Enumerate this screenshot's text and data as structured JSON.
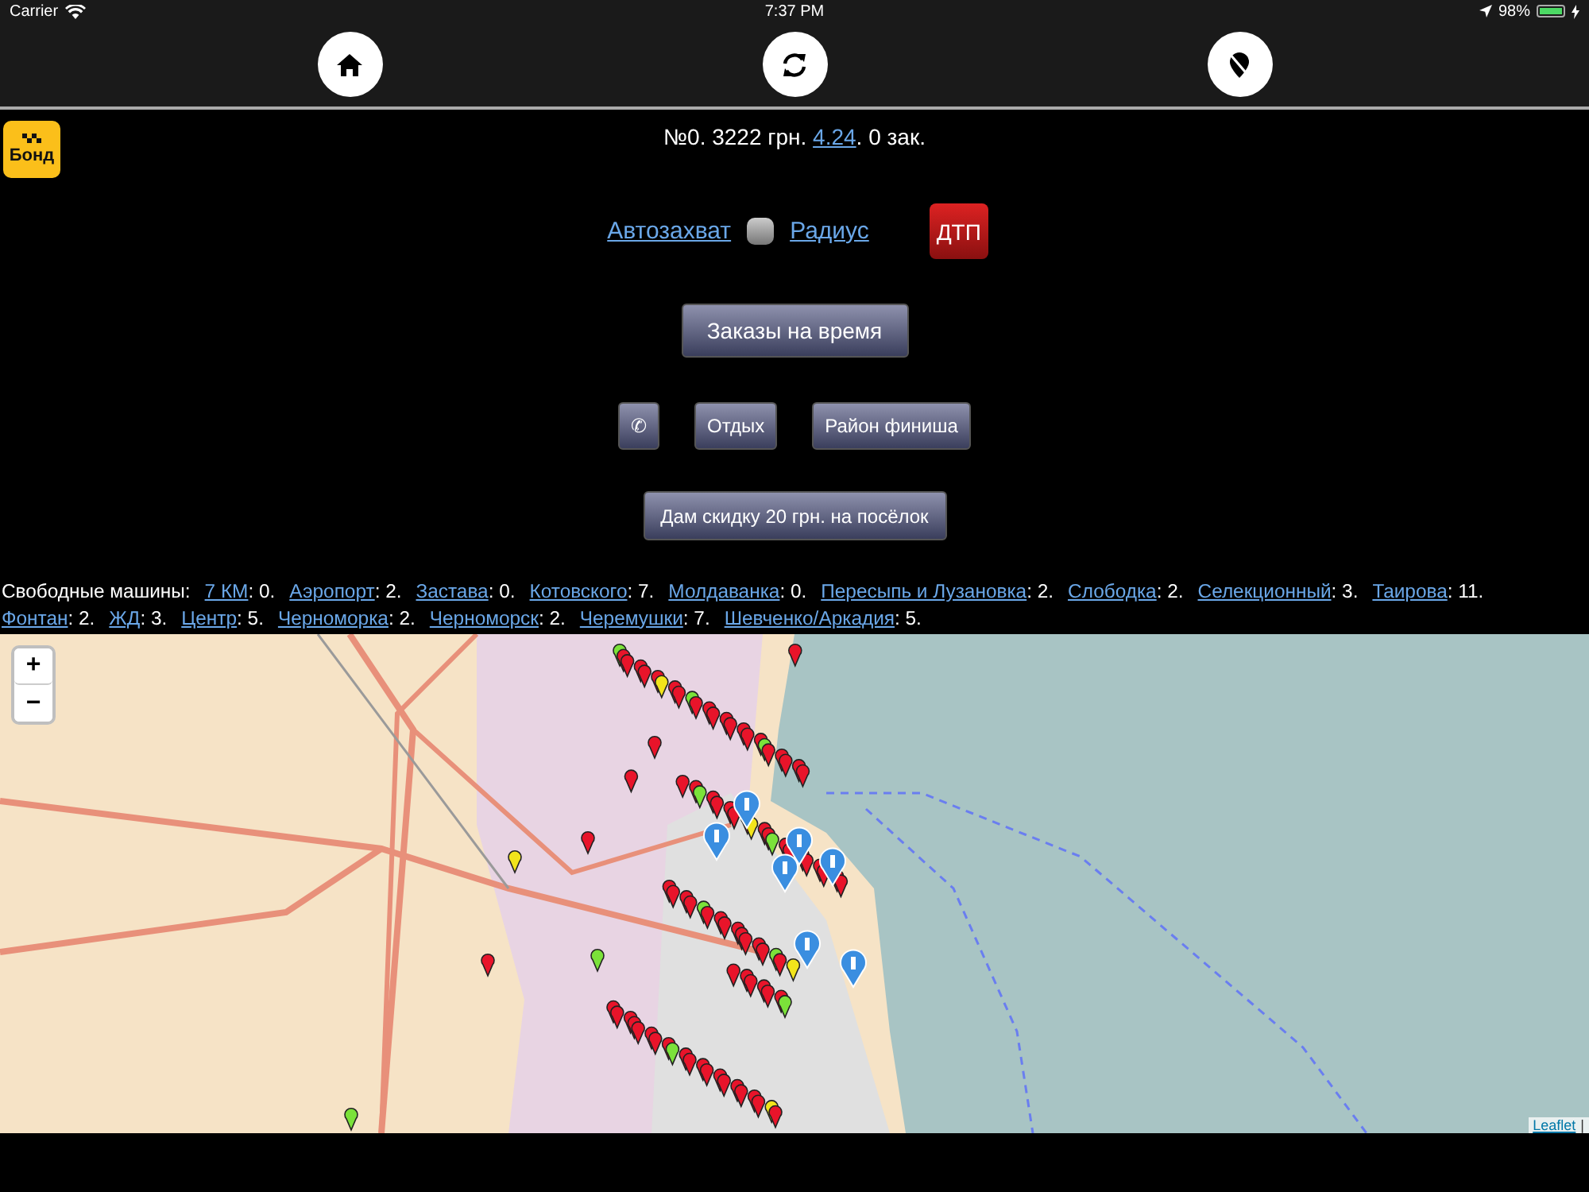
{
  "status_bar": {
    "carrier": "Carrier",
    "time": "7:37 PM",
    "battery": "98%"
  },
  "toolbar": {
    "buttons": [
      {
        "kind": "home"
      },
      {
        "kind": "refresh"
      },
      {
        "kind": "pin-off"
      }
    ]
  },
  "logo": {
    "text": "Бонд"
  },
  "summary": {
    "prefix": "№0. 3222 грн. ",
    "link": "4.24",
    "suffix": ". 0 зак."
  },
  "controls": {
    "autocapture": {
      "label": "Автозахват",
      "checked": false
    },
    "radius": "Радиус",
    "accident": "ДТП"
  },
  "orders_button": "Заказы на время",
  "action_buttons": [
    {
      "label": "✆"
    },
    {
      "label": "Отдых"
    },
    {
      "label": "Район финиша"
    }
  ],
  "discount_button": "Дам скидку 20 грн. на посёлок",
  "free_cars": {
    "label": "Свободные машины:",
    "districts": [
      {
        "name": "7 КМ",
        "count": ": 0."
      },
      {
        "name": "Аэропорт",
        "count": ": 2."
      },
      {
        "name": "Застава",
        "count": ": 0."
      },
      {
        "name": "Котовского",
        "count": ": 7."
      },
      {
        "name": "Молдаванка",
        "count": ": 0."
      },
      {
        "name": "Пересыпь и Лузановка",
        "count": ": 2."
      },
      {
        "name": "Слободка",
        "count": ": 2."
      },
      {
        "name": "Селекционный",
        "count": ": 3."
      },
      {
        "name": "Таирова",
        "count": ": 11."
      },
      {
        "name": "Фонтан",
        "count": ": 2."
      },
      {
        "name": "ЖД",
        "count": ": 3."
      },
      {
        "name": "Центр",
        "count": ": 5."
      },
      {
        "name": "Черноморка",
        "count": ": 2."
      },
      {
        "name": "Черноморск",
        "count": ": 2."
      },
      {
        "name": "Черемушки",
        "count": ": 7."
      },
      {
        "name": "Шевченко/Аркадия",
        "count": ": 5."
      }
    ]
  },
  "map": {
    "zoom_in": "+",
    "zoom_out": "−",
    "attribution": "Leaflet",
    "attribution_separator": "|"
  }
}
